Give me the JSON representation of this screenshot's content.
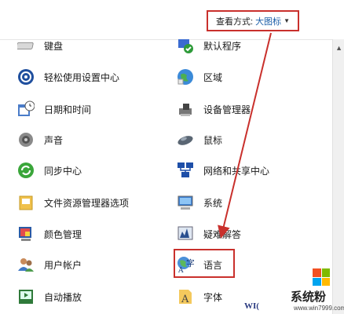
{
  "header": {
    "view_by_label": "查看方式:",
    "view_by_value": "大图标"
  },
  "items": [
    {
      "label": "键盘",
      "icon": "keyboard-icon"
    },
    {
      "label": "默认程序",
      "icon": "default-programs-icon"
    },
    {
      "label": "轻松使用设置中心",
      "icon": "ease-of-access-icon"
    },
    {
      "label": "区域",
      "icon": "region-icon"
    },
    {
      "label": "日期和时间",
      "icon": "date-time-icon"
    },
    {
      "label": "设备管理器",
      "icon": "device-manager-icon"
    },
    {
      "label": "声音",
      "icon": "sound-icon"
    },
    {
      "label": "鼠标",
      "icon": "mouse-icon"
    },
    {
      "label": "同步中心",
      "icon": "sync-center-icon"
    },
    {
      "label": "网络和共享中心",
      "icon": "network-sharing-icon"
    },
    {
      "label": "文件资源管理器选项",
      "icon": "file-explorer-options-icon"
    },
    {
      "label": "系统",
      "icon": "system-icon"
    },
    {
      "label": "颜色管理",
      "icon": "color-management-icon"
    },
    {
      "label": "疑难解答",
      "icon": "troubleshooting-icon"
    },
    {
      "label": "用户帐户",
      "icon": "user-accounts-icon"
    },
    {
      "label": "语言",
      "icon": "language-icon"
    },
    {
      "label": "自动播放",
      "icon": "autoplay-icon"
    },
    {
      "label": "字体",
      "icon": "fonts-icon"
    }
  ],
  "watermark": {
    "title": "系统粉",
    "url": "www.win7999.com",
    "partial_text": "WI("
  },
  "colors": {
    "highlight": "#c9302c",
    "link": "#1c5fa8"
  }
}
